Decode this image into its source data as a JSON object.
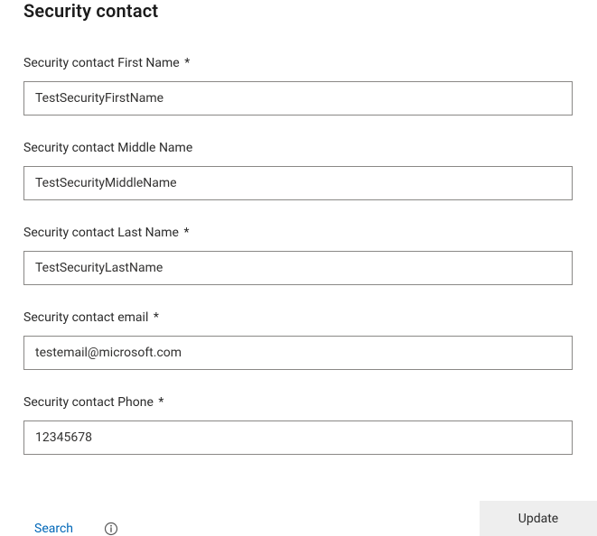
{
  "section": {
    "title": "Security contact"
  },
  "fields": {
    "firstName": {
      "label": "Security contact First Name",
      "required": "*",
      "value": "TestSecurityFirstName"
    },
    "middleName": {
      "label": "Security contact Middle Name",
      "required": "",
      "value": "TestSecurityMiddleName"
    },
    "lastName": {
      "label": "Security contact Last Name",
      "required": "*",
      "value": "TestSecurityLastName"
    },
    "email": {
      "label": "Security contact email",
      "required": "*",
      "value": "testemail@microsoft.com"
    },
    "phone": {
      "label": "Security contact Phone",
      "required": "*",
      "value": "12345678"
    }
  },
  "actions": {
    "search": "Search",
    "update": "Update"
  }
}
